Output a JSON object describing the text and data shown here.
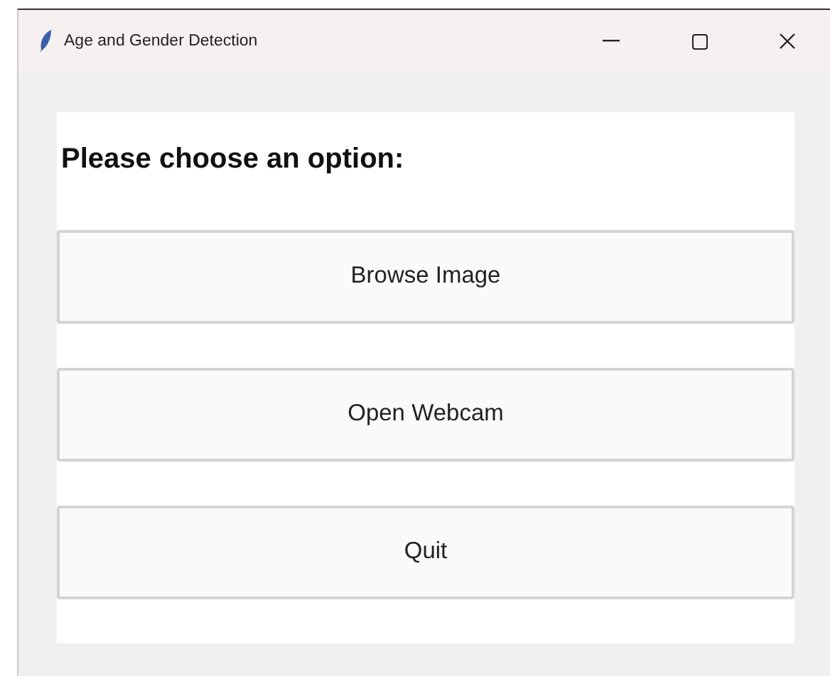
{
  "window": {
    "title": "Age and Gender Detection"
  },
  "prompt": "Please choose an option:",
  "buttons": [
    "Browse Image",
    "Open Webcam",
    "Quit"
  ]
}
